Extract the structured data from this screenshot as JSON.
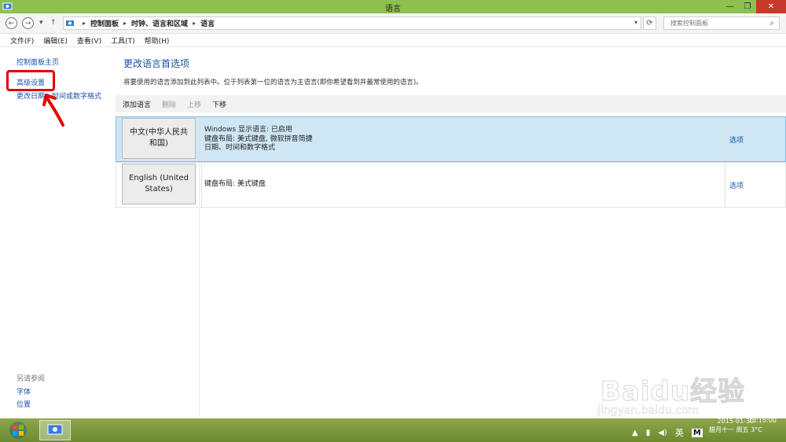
{
  "window": {
    "title": "语言"
  },
  "address": {
    "crumbs": [
      "控制面板",
      "时钟、语言和区域",
      "语言"
    ],
    "search_placeholder": "搜索控制面板"
  },
  "menu": [
    "文件(F)",
    "编辑(E)",
    "查看(V)",
    "工具(T)",
    "帮助(H)"
  ],
  "sidebar": {
    "home": "控制面板主页",
    "advanced": "高级设置",
    "change_date": "更改日期、时间或数字格式",
    "see_also": "另请参阅",
    "fonts": "字体",
    "location": "位置"
  },
  "main": {
    "heading": "更改语言首选项",
    "description": "将要使用的语言添加到此列表中。位于列表第一位的语言为主语言(即你希望看到并最常使用的语言)。",
    "toolbar": {
      "add": "添加语言",
      "remove": "删除",
      "up": "上移",
      "down": "下移"
    },
    "languages": [
      {
        "name": "中文(中华人民共和国)",
        "info": [
          "Windows 显示语言: 已启用",
          "键盘布局: 美式键盘, 微软拼音简捷",
          "日期、时间和数字格式"
        ],
        "options": "选项",
        "selected": true
      },
      {
        "name": "English (United States)",
        "info": [
          "键盘布局: 美式键盘"
        ],
        "options": "选项",
        "selected": false
      }
    ]
  },
  "taskbar": {
    "ime": "英",
    "ime_mode": "M",
    "time": "13:15:00",
    "date": "2015-01-30",
    "lunar": "腊月十一 周五 3°C"
  },
  "watermark": {
    "brand": "Baidu经验",
    "url": "jingyan.baidu.com"
  },
  "colors": {
    "titlebar": "#8cc04f",
    "link": "#1a54a8",
    "selected_row": "#cfe6f5",
    "annotation": "#e30000"
  }
}
